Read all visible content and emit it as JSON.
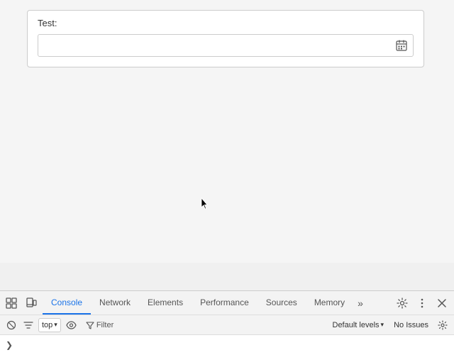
{
  "page": {
    "background_color": "#f5f5f5"
  },
  "test_form": {
    "label": "Test:",
    "input_placeholder": "",
    "input_value": ""
  },
  "devtools": {
    "tabs": [
      {
        "id": "console",
        "label": "Console",
        "active": true
      },
      {
        "id": "network",
        "label": "Network",
        "active": false
      },
      {
        "id": "elements",
        "label": "Elements",
        "active": false
      },
      {
        "id": "performance",
        "label": "Performance",
        "active": false
      },
      {
        "id": "sources",
        "label": "Sources",
        "active": false
      },
      {
        "id": "memory",
        "label": "Memory",
        "active": false
      }
    ],
    "overflow_label": "»",
    "toolbar": {
      "top_selector_value": "top",
      "top_selector_arrow": "▾",
      "filter_label": "Filter",
      "default_levels_label": "Default levels",
      "default_levels_arrow": "▾",
      "no_issues_label": "No Issues"
    }
  }
}
